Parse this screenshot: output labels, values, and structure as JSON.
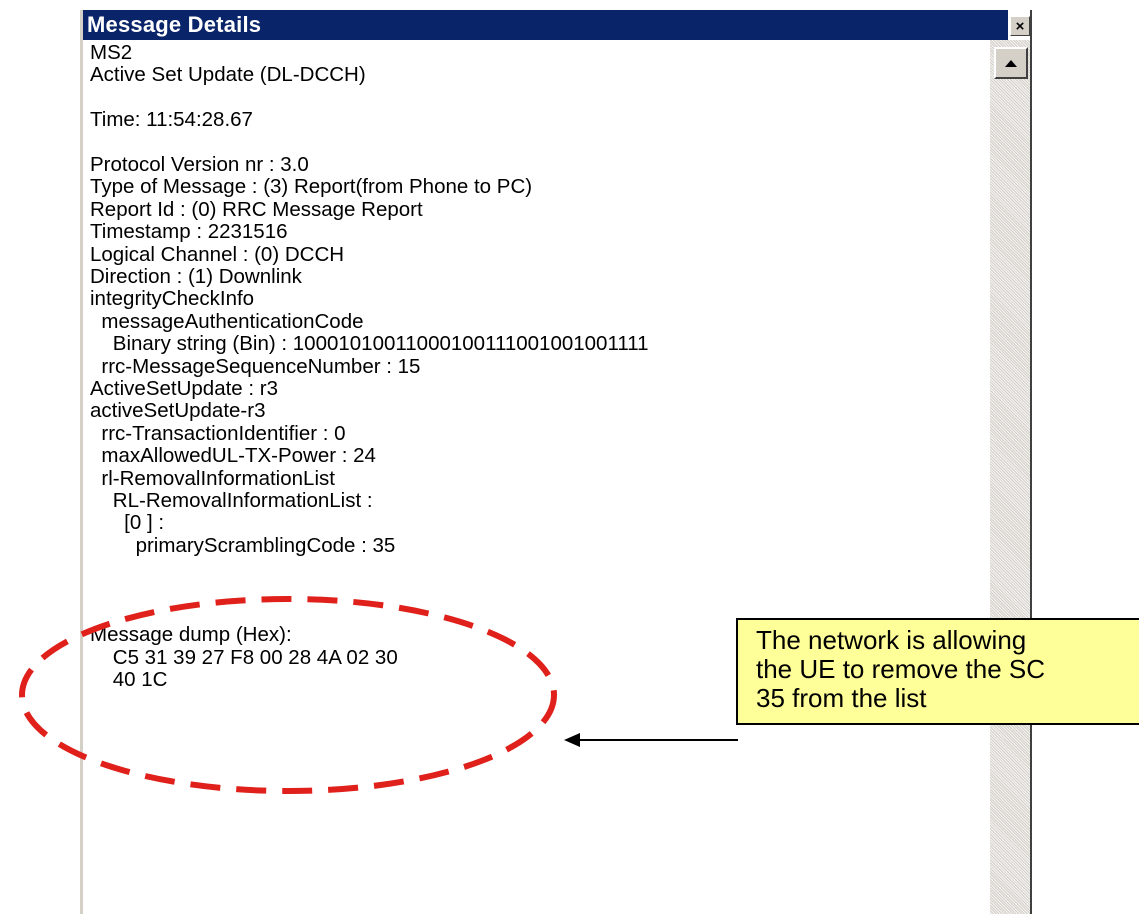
{
  "window": {
    "title": "Message Details",
    "close_glyph": "×",
    "close_icon": "close-icon",
    "scroll_up_icon": "scroll-up-arrow-icon"
  },
  "lines": [
    "MS2",
    "Active Set Update (DL-DCCH)",
    "",
    "Time: 11:54:28.67",
    "",
    "Protocol Version nr : 3.0",
    "Type of Message : (3) Report(from Phone to PC)",
    "Report Id : (0) RRC Message Report",
    "Timestamp : 2231516",
    "Logical Channel : (0) DCCH",
    "Direction : (1) Downlink",
    "integrityCheckInfo",
    "  messageAuthenticationCode",
    "    Binary string (Bin) : 10001010011000100111001001001111",
    "  rrc-MessageSequenceNumber : 15",
    "ActiveSetUpdate : r3",
    "activeSetUpdate-r3",
    "  rrc-TransactionIdentifier : 0",
    "  maxAllowedUL-TX-Power : 24",
    "  rl-RemovalInformationList",
    "    RL-RemovalInformationList :",
    "      [0 ] :",
    "        primaryScramblingCode : 35",
    "",
    "",
    "",
    "Message dump (Hex):",
    "    C5 31 39 27 F8 00 28 4A 02 30",
    "    40 1C"
  ],
  "callout": {
    "lines": [
      "The network is allowing",
      "the UE to remove the SC",
      "35 from the list"
    ]
  },
  "colors": {
    "titlebar": "#0a246a",
    "callout_fill": "#ffff99",
    "highlight_ellipse": "#e0201a"
  }
}
